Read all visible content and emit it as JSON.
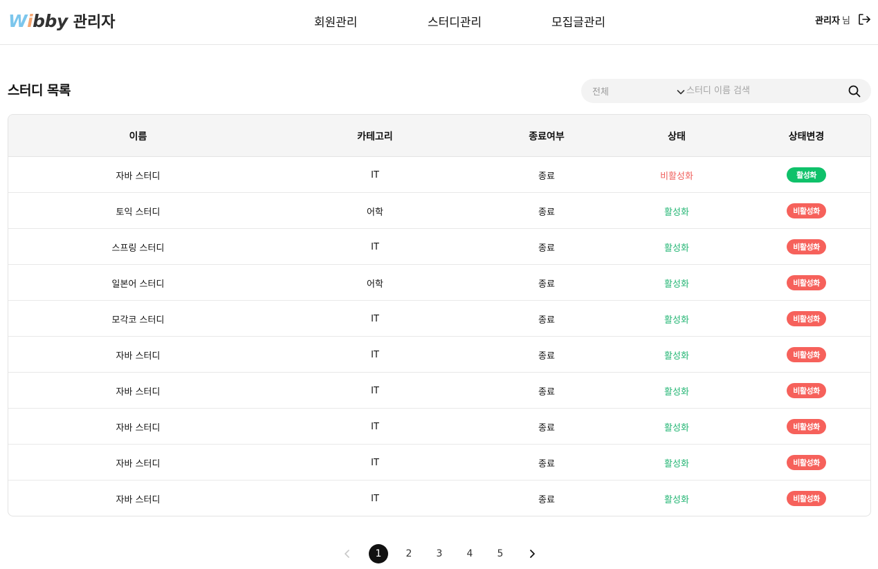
{
  "header": {
    "logo": {
      "w": "W",
      "i": "i",
      "rest": "bby",
      "admin_label": "관리자"
    },
    "nav": [
      {
        "label": "회원관리"
      },
      {
        "label": "스터디관리"
      },
      {
        "label": "모집글관리"
      }
    ],
    "user": {
      "name": "관리자",
      "suffix": "님",
      "logout_icon": "logout-icon"
    }
  },
  "page": {
    "title": "스터디 목록"
  },
  "search": {
    "filter_value": "전체",
    "placeholder": "스터디 이름 검색",
    "value": "",
    "filter_icon": "chevron-down-icon",
    "search_icon": "search-icon"
  },
  "table": {
    "columns": [
      "이름",
      "카테고리",
      "종료여부",
      "상태",
      "상태변경"
    ],
    "rows": [
      {
        "name": "자바 스터디",
        "category": "IT",
        "ended": "종료",
        "status": "비활성화",
        "action": "활성화"
      },
      {
        "name": "토익 스터디",
        "category": "어학",
        "ended": "종료",
        "status": "활성화",
        "action": "비활성화"
      },
      {
        "name": "스프링 스터디",
        "category": "IT",
        "ended": "종료",
        "status": "활성화",
        "action": "비활성화"
      },
      {
        "name": "일본어 스터디",
        "category": "어학",
        "ended": "종료",
        "status": "활성화",
        "action": "비활성화"
      },
      {
        "name": "모각코 스터디",
        "category": "IT",
        "ended": "종료",
        "status": "활성화",
        "action": "비활성화"
      },
      {
        "name": "자바 스터디",
        "category": "IT",
        "ended": "종료",
        "status": "활성화",
        "action": "비활성화"
      },
      {
        "name": "자바 스터디",
        "category": "IT",
        "ended": "종료",
        "status": "활성화",
        "action": "비활성화"
      },
      {
        "name": "자바 스터디",
        "category": "IT",
        "ended": "종료",
        "status": "활성화",
        "action": "비활성화"
      },
      {
        "name": "자바 스터디",
        "category": "IT",
        "ended": "종료",
        "status": "활성화",
        "action": "비활성화"
      },
      {
        "name": "자바 스터디",
        "category": "IT",
        "ended": "종료",
        "status": "활성화",
        "action": "비활성화"
      }
    ]
  },
  "pagination": {
    "pages": [
      "1",
      "2",
      "3",
      "4",
      "5"
    ],
    "current": "1",
    "prev_icon": "chevron-left-icon",
    "next_icon": "chevron-right-icon"
  },
  "colors": {
    "active": "#22b573",
    "inactive": "#f0605d",
    "pill_active": "#0fc16a",
    "pill_inactive": "#f6615b",
    "logo_w": "#7cc6ec",
    "logo_i": "#f4a672"
  }
}
